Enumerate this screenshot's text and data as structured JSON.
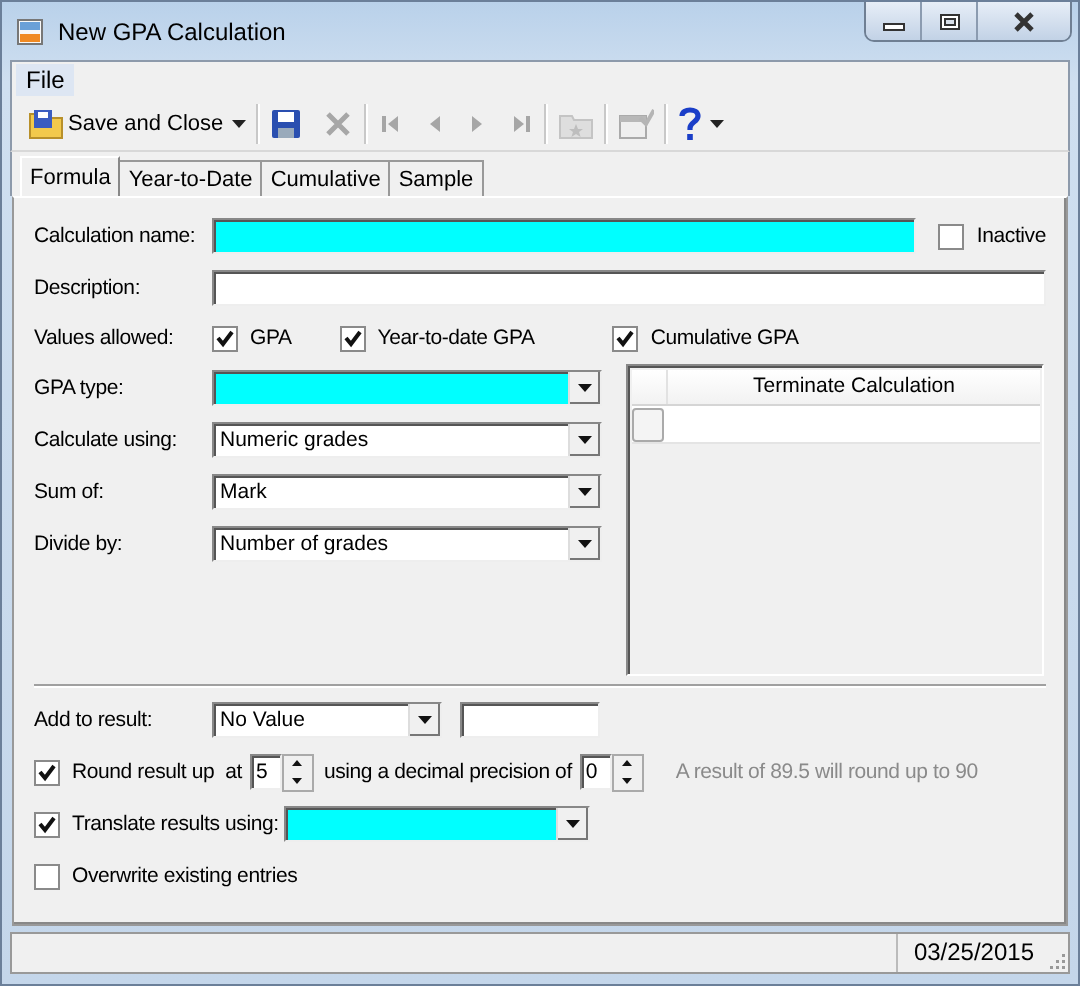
{
  "window": {
    "title": "New GPA Calculation"
  },
  "menu": [
    {
      "label": "File",
      "selected": true
    }
  ],
  "toolbar": [
    {
      "kind": "button",
      "label": "Save and Close",
      "dropdown": true,
      "disabled": false
    },
    {
      "kind": "separator"
    },
    {
      "kind": "icon",
      "disabled": false
    },
    {
      "kind": "icon",
      "disabled": true
    },
    {
      "kind": "separator"
    },
    {
      "kind": "icon",
      "disabled": true
    },
    {
      "kind": "icon",
      "disabled": true
    },
    {
      "kind": "icon",
      "disabled": true
    },
    {
      "kind": "icon",
      "disabled": true
    },
    {
      "kind": "separator"
    },
    {
      "kind": "icon",
      "disabled": true
    },
    {
      "kind": "separator"
    },
    {
      "kind": "icon",
      "disabled": true
    },
    {
      "kind": "separator"
    },
    {
      "kind": "icon",
      "disabled": false,
      "dropdown": true
    }
  ],
  "tabs": [
    {
      "label": "Formula",
      "selected": true
    },
    {
      "label": "Year-to-Date",
      "selected": false
    },
    {
      "label": "Cumulative",
      "selected": false
    },
    {
      "label": "Sample",
      "selected": false
    }
  ],
  "form": {
    "calculation_name": {
      "label": "Calculation name:",
      "required": true
    },
    "inactive": {
      "label": "Inactive",
      "checked": false
    },
    "description": {
      "label": "Description:",
      "required": false
    },
    "values_allowed": {
      "label": "Values allowed:",
      "options": [
        {
          "label": "GPA",
          "checked": true
        },
        {
          "label": "Year-to-date GPA",
          "checked": true
        },
        {
          "label": "Cumulative GPA",
          "checked": true
        }
      ]
    },
    "selects": [
      {
        "label": "GPA type:",
        "required": true
      },
      {
        "label": "Calculate using:",
        "value": "Numeric grades",
        "required": false
      },
      {
        "label": "Sum of:",
        "value": "Mark",
        "required": false
      },
      {
        "label": "Divide by:",
        "value": "Number of grades",
        "required": false
      }
    ],
    "terminate_grid": {
      "columns": [
        "Terminate Calculation"
      ],
      "rows": [
        {
          "checked": false
        }
      ]
    },
    "add_to_result": {
      "label": "Add to result:",
      "value": "No Value"
    },
    "round": {
      "checked": true,
      "label": "Round result up  at",
      "value": "5",
      "precision_label": "using a decimal precision of",
      "precision": "0",
      "hint": "A result of 89.5 will round up to 90"
    },
    "translate": {
      "checked": true,
      "label": "Translate results using:",
      "required": true
    },
    "overwrite": {
      "checked": false,
      "label": "Overwrite existing entries"
    }
  },
  "status_bar": {
    "date": "03/25/2015"
  }
}
